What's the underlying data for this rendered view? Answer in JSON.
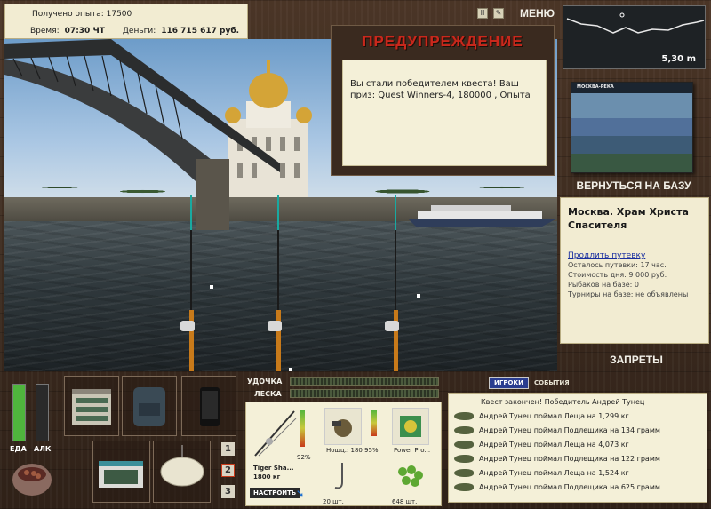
{
  "info": {
    "exp_label": "Получено опыта:",
    "exp_value": "17500",
    "time_label": "Время:",
    "time_value": "07:30 ЧТ",
    "money_label": "Деньги:",
    "money_value": "116 715 617 руб."
  },
  "toolbar": {
    "pause_glyph": "II",
    "edit_glyph": "✎",
    "menu_label": "МЕНЮ"
  },
  "depth": {
    "value": "5,30 m"
  },
  "warning": {
    "title": "ПРЕДУПРЕЖДЕНИЕ",
    "message": "Вы стали победителем квеста! Ваш приз: Quest Winners-4, 180000 , Опыта"
  },
  "location": {
    "photo_caption": "МОСКВА-РЕКА",
    "return_label": "ВЕРНУТЬСЯ НА БАЗУ",
    "title": "Москва. Храм Христа Спасителя",
    "extend_link": "Продлить путевку",
    "lines": [
      "Осталось путевки: 17 час.",
      "Стоимость дня: 9 000 руб.",
      "Рыбаков на базе: 0",
      "Турниры на базе: не объявлены"
    ],
    "bans_label": "ЗАПРЕТЫ"
  },
  "meters": {
    "food_label": "ЕДА",
    "food_level": 1.0,
    "alc_label": "АЛК",
    "alc_level": 0.0
  },
  "page_numbers": [
    "1",
    "2",
    "3"
  ],
  "bars": {
    "rod_label": "УДОЧКА",
    "line_label": "ЛЕСКА"
  },
  "tackle": {
    "rod_name": "Tiger Sha...",
    "rod_weight": "1800 кг",
    "rod_percent": "92%",
    "setup_label": "НАСТРОИТЬ",
    "reel_name": "Ношц.: 180",
    "reel_percent": "95%",
    "line_name": "Power Pro...",
    "hook_count": "20 шт.",
    "bait_count": "648 шт."
  },
  "events": {
    "tab_players": "ИГРОКИ",
    "tab_events": "СОБЫТИЯ",
    "header": "Квест закончен! Победитель Андрей Тунец",
    "items": [
      "Андрей Тунец поймал Леща на 1,299 кг",
      "Андрей Тунец поймал Подлещика на 134 грамм",
      "Андрей Тунец поймал Леща на 4,073 кг",
      "Андрей Тунец поймал Подлещика на 122 грамм",
      "Андрей Тунец поймал Леща на 1,524 кг",
      "Андрей Тунец поймал Подлещика на 625 грамм"
    ]
  },
  "colors": {
    "warning_title": "#c8281c",
    "food_meter": "#4fb53d",
    "players_tab": "#2a3d8f"
  }
}
